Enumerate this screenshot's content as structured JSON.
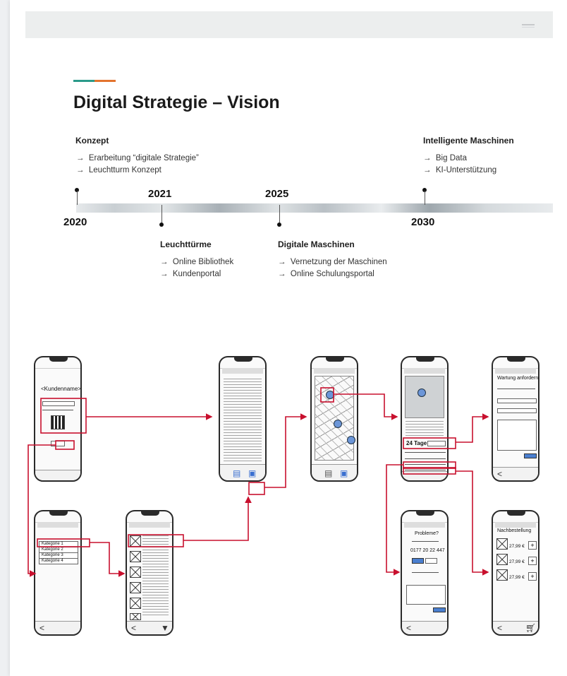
{
  "title": "Digital Strategie – Vision",
  "accent_colors": {
    "teal": "#2b9a8a",
    "orange": "#e3742e",
    "flow_red": "#c8102e",
    "mock_blue": "#4a7fd0"
  },
  "timeline": {
    "years": [
      "2020",
      "2021",
      "2025",
      "2030"
    ],
    "above": [
      {
        "heading": "Konzept",
        "items": [
          "Erarbeitung “digitale Strategie”",
          "Leuchtturm Konzept"
        ]
      },
      {
        "heading": "Intelligente Maschinen",
        "items": [
          "Big Data",
          "KI-Unterstützung"
        ]
      }
    ],
    "below": [
      {
        "heading": "Leuchttürme",
        "items": [
          "Online Bibliothek",
          "Kundenportal"
        ]
      },
      {
        "heading": "Digitale Maschinen",
        "items": [
          "Vernetzung der Maschinen",
          "Online Schulungsportal"
        ]
      }
    ],
    "arrow_glyph": "→"
  },
  "wireframes": {
    "login": {
      "brand": "<Kundenname>"
    },
    "categories": {
      "items": [
        "Kategorie 1",
        "Kategorie 2",
        "Kategorie 3",
        "Kategorie 4"
      ]
    },
    "machine": {
      "days": "24 Tage"
    },
    "maintenance": {
      "title": "Wartung anfordern"
    },
    "problem": {
      "title": "Probleme?",
      "phone": "0177 20 22 447"
    },
    "order": {
      "title": "Nachbestellung",
      "prices": [
        "27,99 €",
        "27,99 €",
        "27,99 €"
      ],
      "add_glyph": "+"
    }
  }
}
